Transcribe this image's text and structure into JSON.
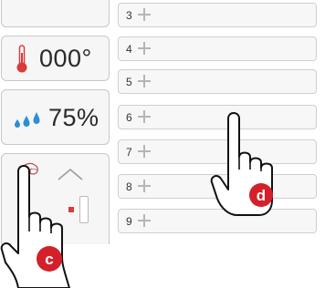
{
  "widgets": {
    "temperature": {
      "value": "000°",
      "icon": "thermometer-icon"
    },
    "humidity": {
      "value": "75%",
      "icon": "water-drops-icon"
    },
    "control": {
      "icons": [
        "curl-icon",
        "chevron-up-icon"
      ]
    }
  },
  "list": {
    "rows": [
      {
        "number": "3"
      },
      {
        "number": "4"
      },
      {
        "number": "5"
      },
      {
        "number": "6"
      },
      {
        "number": "7"
      },
      {
        "number": "8"
      },
      {
        "number": "9"
      }
    ]
  },
  "callouts": {
    "c": "c",
    "d": "d"
  },
  "colors": {
    "accent_red": "#d4202a",
    "thermometer_red": "#d93a3a",
    "drop_blue": "#2b8fd6"
  }
}
